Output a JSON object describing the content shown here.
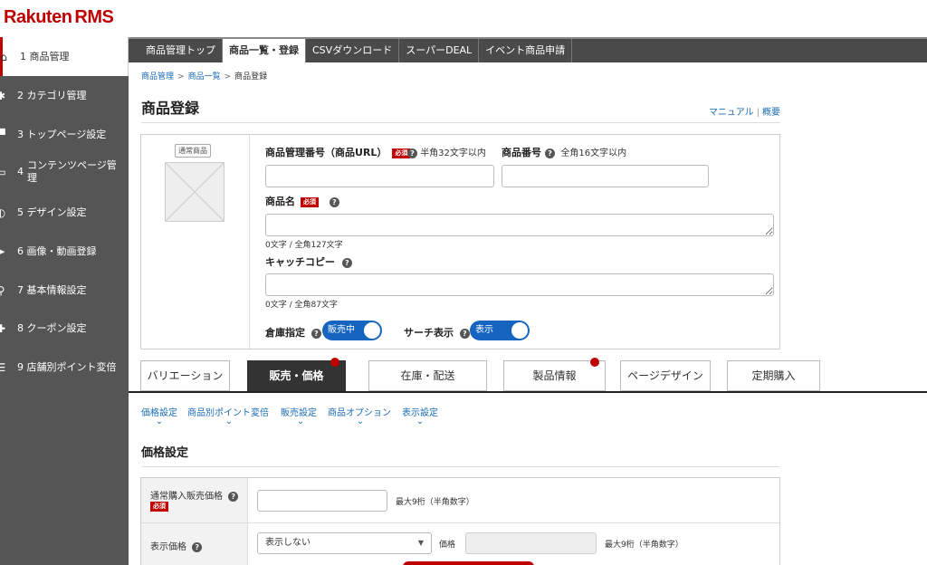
{
  "brand": {
    "logo_main": "Rakuten",
    "logo_sub": "RMS",
    "color": "#bf0000"
  },
  "sidebar": {
    "items": [
      {
        "num": "1",
        "label": "商品管理",
        "icon": "home-icon",
        "active": true
      },
      {
        "num": "2",
        "label": "カテゴリ管理",
        "icon": "gear-icon"
      },
      {
        "num": "3",
        "label": "トップページ設定",
        "icon": "cart-icon"
      },
      {
        "num": "4",
        "label": "コンテンツページ管理",
        "icon": "monitor-icon"
      },
      {
        "num": "5",
        "label": "デザイン設定",
        "icon": "palette-icon"
      },
      {
        "num": "6",
        "label": "画像・動画登録",
        "icon": "send-icon"
      },
      {
        "num": "7",
        "label": "基本情報設定",
        "icon": "wrench-icon"
      },
      {
        "num": "8",
        "label": "クーポン設定",
        "icon": "puzzle-icon"
      },
      {
        "num": "9",
        "label": "店舗別ポイント変倍",
        "icon": "coin-icon"
      }
    ]
  },
  "topnav": {
    "tabs": [
      {
        "label": "商品管理トップ"
      },
      {
        "label": "商品一覧・登録",
        "active": true
      },
      {
        "label": "CSVダウンロード"
      },
      {
        "label": "スーパーDEAL"
      },
      {
        "label": "イベント商品申請"
      }
    ]
  },
  "breadcrumb": {
    "items": [
      "商品管理",
      "商品一覧",
      "商品登録"
    ],
    "sep": ">"
  },
  "page": {
    "title": "商品登録",
    "link_manual": "マニュアル",
    "link_overview": "概要",
    "link_sep": "|"
  },
  "product": {
    "type_tag": "通常商品",
    "required_label": "必須",
    "manage_no": {
      "label": "商品管理番号（商品URL）",
      "hint": "半角32文字以内",
      "value": ""
    },
    "product_no": {
      "label": "商品番号",
      "hint": "全角16文字以内",
      "value": ""
    },
    "name": {
      "label": "商品名",
      "count": "0文字 / 全角127文字",
      "value": ""
    },
    "catch_copy": {
      "label": "キャッチコピー",
      "count": "0文字 / 全角87文字",
      "value": ""
    },
    "warehouse": {
      "label": "倉庫指定",
      "toggle_label": "販売中"
    },
    "search": {
      "label": "サーチ表示",
      "toggle_label": "表示"
    },
    "help_glyph": "?"
  },
  "tabs": [
    {
      "label": "バリエーション"
    },
    {
      "label": "販売・価格",
      "active": true,
      "dot": true
    },
    {
      "label": "在庫・配送"
    },
    {
      "label": "製品情報",
      "dot": true
    },
    {
      "label": "ページデザイン"
    },
    {
      "label": "定期購入"
    }
  ],
  "subnav": [
    "価格設定",
    "商品別ポイント変倍",
    "販売設定",
    "商品オプション",
    "表示設定"
  ],
  "price_section": {
    "title": "価格設定",
    "rows": [
      {
        "label": "通常購入販売価格",
        "required": "必須",
        "hint": "最大9桁（半角数字）",
        "value": ""
      },
      {
        "label": "表示価格",
        "select_value": "表示しない",
        "price_label": "価格",
        "hint": "最大9桁（半角数字）"
      }
    ]
  }
}
